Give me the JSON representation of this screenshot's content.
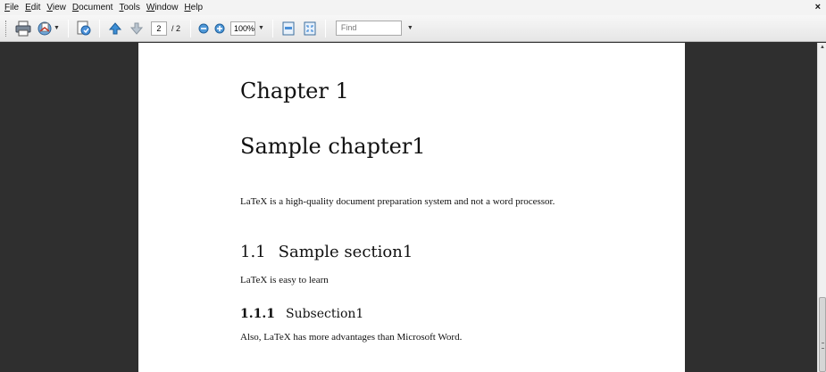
{
  "menu": {
    "items": [
      {
        "mnemonic": "F",
        "rest": "ile"
      },
      {
        "mnemonic": "E",
        "rest": "dit"
      },
      {
        "mnemonic": "V",
        "rest": "iew"
      },
      {
        "mnemonic": "D",
        "rest": "ocument"
      },
      {
        "mnemonic": "T",
        "rest": "ools"
      },
      {
        "mnemonic": "W",
        "rest": "indow"
      },
      {
        "mnemonic": "H",
        "rest": "elp"
      }
    ],
    "close_label": "×"
  },
  "toolbar": {
    "current_page": "2",
    "page_total": "/ 2",
    "zoom": "100%",
    "find_placeholder": "Find"
  },
  "document": {
    "chapter_label": "Chapter 1",
    "chapter_title": "Sample chapter1",
    "para1": "LaTeX is a high-quality document preparation system and not a word processor.",
    "section_number": "1.1",
    "section_title": "Sample section1",
    "para2": "LaTeX is easy to learn",
    "subsection_number": "1.1.1",
    "subsection_title": "Subsection1",
    "para3": "Also, LaTeX has more advantages than Microsoft Word."
  },
  "icons": [
    "print-icon",
    "email-icon",
    "document-settings-icon",
    "previous-page-icon",
    "next-page-icon",
    "zoom-out-icon",
    "zoom-in-icon",
    "fit-page-icon",
    "fit-width-icon"
  ],
  "colors": {
    "viewer_background": "#2f2f2f",
    "page": "#ffffff",
    "toolbar": "#ececec"
  }
}
